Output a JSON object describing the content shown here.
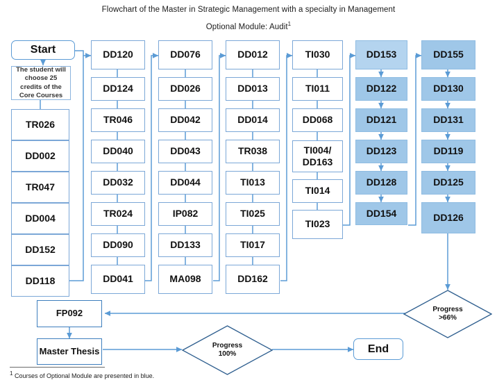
{
  "titles": {
    "main": "Flowchart of the Master in Strategic Management with a specialty in Management",
    "sub": "Optional Module: Audit",
    "sub_superscript": "1"
  },
  "start": {
    "label": "Start"
  },
  "note": {
    "label": "The student will choose 25 credits of the Core Courses"
  },
  "columns": [
    {
      "name": "core-courses-column-1",
      "style": "white",
      "items": [
        {
          "label": "TR026"
        },
        {
          "label": "DD002"
        },
        {
          "label": "TR047"
        },
        {
          "label": "DD004"
        },
        {
          "label": "DD152"
        },
        {
          "label": "DD118"
        }
      ]
    },
    {
      "name": "core-courses-column-2",
      "style": "white",
      "items": [
        {
          "label": "DD120"
        },
        {
          "label": "DD124"
        },
        {
          "label": "TR046"
        },
        {
          "label": "DD040"
        },
        {
          "label": "DD032"
        },
        {
          "label": "TR024"
        },
        {
          "label": "DD090"
        },
        {
          "label": "DD041"
        }
      ]
    },
    {
      "name": "core-courses-column-3",
      "style": "white",
      "items": [
        {
          "label": "DD076"
        },
        {
          "label": "DD026"
        },
        {
          "label": "DD042"
        },
        {
          "label": "DD043"
        },
        {
          "label": "DD044"
        },
        {
          "label": "IP082"
        },
        {
          "label": "DD133"
        },
        {
          "label": "MA098"
        }
      ]
    },
    {
      "name": "core-courses-column-4",
      "style": "white",
      "items": [
        {
          "label": "DD012"
        },
        {
          "label": "DD013"
        },
        {
          "label": "DD014"
        },
        {
          "label": "TR038"
        },
        {
          "label": "TI013"
        },
        {
          "label": "TI025"
        },
        {
          "label": "TI017"
        },
        {
          "label": "DD162"
        }
      ]
    },
    {
      "name": "core-courses-column-5",
      "style": "white",
      "items": [
        {
          "label": "TI030"
        },
        {
          "label": "TI011"
        },
        {
          "label": "DD068"
        },
        {
          "label": "TI004/\nDD163"
        },
        {
          "label": "TI014"
        },
        {
          "label": "TI023"
        }
      ]
    },
    {
      "name": "optional-module-column-6",
      "style": "blue",
      "items": [
        {
          "label": "DD153"
        },
        {
          "label": "DD122"
        },
        {
          "label": "DD121"
        },
        {
          "label": "DD123"
        },
        {
          "label": "DD128"
        },
        {
          "label": "DD154"
        }
      ]
    },
    {
      "name": "optional-module-column-7",
      "style": "blue",
      "items": [
        {
          "label": "DD155"
        },
        {
          "label": "DD130"
        },
        {
          "label": "DD131"
        },
        {
          "label": "DD119"
        },
        {
          "label": "DD125"
        },
        {
          "label": "DD126"
        }
      ]
    }
  ],
  "decisions": {
    "progress_66": {
      "line1": "Progress",
      "line2": ">66%"
    },
    "progress_100": {
      "line1": "Progress",
      "line2": "100%"
    }
  },
  "final_nodes": {
    "fp092": {
      "label": "FP092"
    },
    "master_thesis": {
      "label": "Master Thesis"
    },
    "end": {
      "label": "End"
    }
  },
  "footnote": {
    "marker": "1",
    "text": "Courses of Optional Module are presented in blue."
  },
  "colors": {
    "connector": "#5b9bd5",
    "box_border": "#7ba7d7",
    "blue_fill": "#9fc7e8",
    "blue_fill_light": "#b4d4ef",
    "diamond_border": "#2f5f8f",
    "thick_border": "#3d7ebd"
  }
}
